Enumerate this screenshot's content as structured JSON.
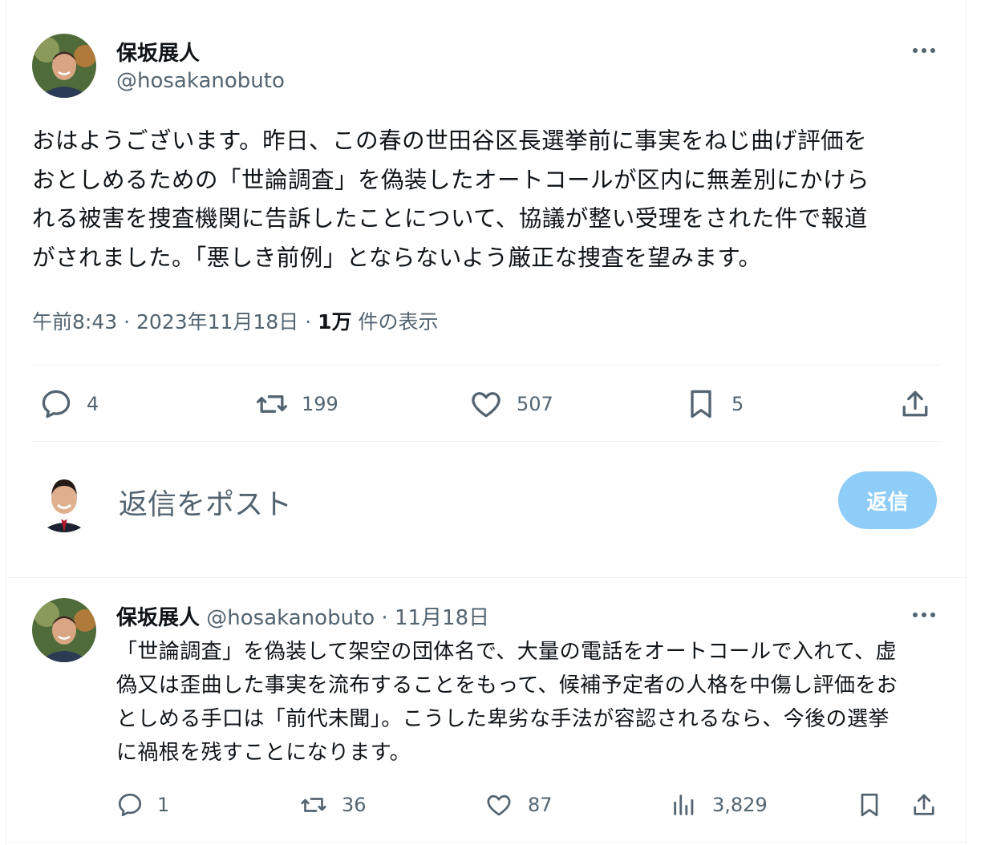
{
  "colors": {
    "text": "#0f1419",
    "secondary": "#536471",
    "accent_disabled": "#8ecdf8",
    "divider": "#eff3f4"
  },
  "main_tweet": {
    "author_name": "保坂展人",
    "author_handle": "@hosakanobuto",
    "more_icon": "more-icon",
    "text": "おはようございます。昨日、この春の世田谷区長選挙前に事実をねじ曲げ評価を\nおとしめるための「世論調査」を偽装したオートコールが区内に無差別にかけら\nれる被害を捜査機関に告訴したことについて、協議が整い受理をされた件で報道\nがされました。「悪しき前例」とならないよう厳正な捜査を望みます。",
    "time": "午前8:43",
    "sep1": "·",
    "date": "2023年11月18日",
    "sep2": "·",
    "views_count": "1万",
    "views_label": "件の表示",
    "actions": {
      "reply_count": "4",
      "retweet_count": "199",
      "like_count": "507",
      "bookmark_count": "5"
    }
  },
  "composer": {
    "placeholder": "返信をポスト",
    "button_label": "返信"
  },
  "reply_tweet": {
    "author_name": "保坂展人",
    "author_handle": "@hosakanobuto",
    "sep": "·",
    "date": "11月18日",
    "text": "「世論調査」を偽装して架空の団体名で、大量の電話をオートコールで入れて、虚\n偽又は歪曲した事実を流布することをもって、候補予定者の人格を中傷し評価をお\nとしめる手口は「前代未聞」。こうした卑劣な手法が容認されるなら、今後の選挙\nに禍根を残すことになります。",
    "actions": {
      "reply_count": "1",
      "retweet_count": "36",
      "like_count": "87",
      "views_count": "3,829"
    }
  }
}
